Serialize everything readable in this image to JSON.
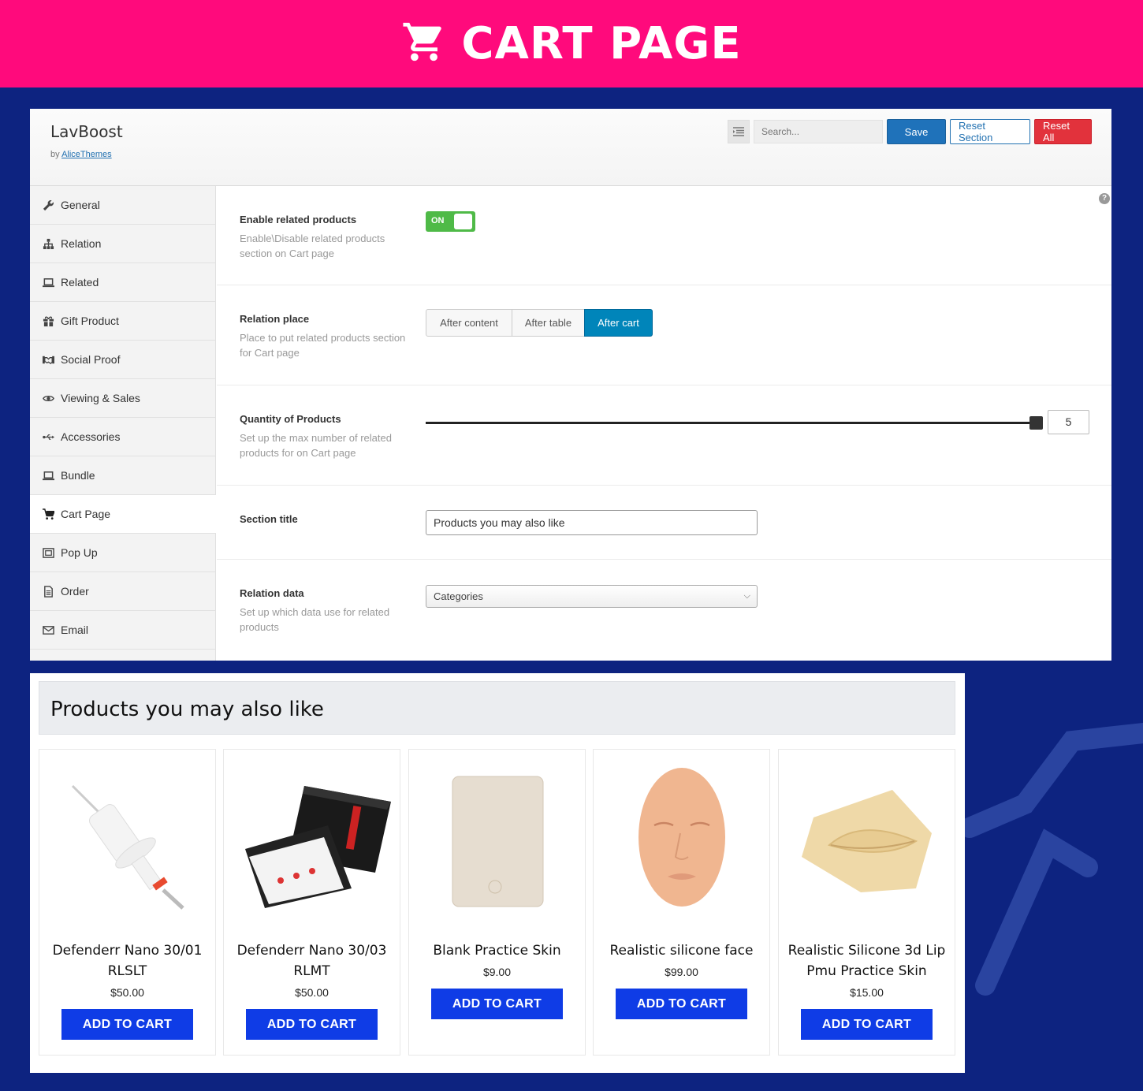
{
  "banner": {
    "title": "CART PAGE",
    "icon": "cart-icon"
  },
  "admin": {
    "brand": "LavBoost",
    "by_prefix": "by",
    "by_link": "AliceThemes",
    "search_placeholder": "Search...",
    "save_label": "Save",
    "reset_section_label": "Reset Section",
    "reset_all_label": "Reset All",
    "help_glyph": "?",
    "sidebar": [
      {
        "label": "General",
        "icon": "wrench-icon"
      },
      {
        "label": "Relation",
        "icon": "sitemap-icon"
      },
      {
        "label": "Related",
        "icon": "laptop-icon"
      },
      {
        "label": "Gift Product",
        "icon": "gift-icon"
      },
      {
        "label": "Social Proof",
        "icon": "handshake-icon"
      },
      {
        "label": "Viewing & Sales",
        "icon": "eye-icon"
      },
      {
        "label": "Accessories",
        "icon": "usb-icon"
      },
      {
        "label": "Bundle",
        "icon": "laptop-icon"
      },
      {
        "label": "Cart Page",
        "icon": "cart-icon",
        "active": true
      },
      {
        "label": "Pop Up",
        "icon": "popup-icon"
      },
      {
        "label": "Order",
        "icon": "document-icon"
      },
      {
        "label": "Email",
        "icon": "envelope-icon"
      }
    ],
    "settings": {
      "enable": {
        "title": "Enable related products",
        "desc": "Enable\\Disable related products section on Cart page",
        "toggle_label": "ON",
        "value": true
      },
      "place": {
        "title": "Relation place",
        "desc": "Place to put related products section for Cart page",
        "options": [
          "After content",
          "After table",
          "After cart"
        ],
        "selected": "After cart"
      },
      "quantity": {
        "title": "Quantity of Products",
        "desc": "Set up the max number of related products for on Cart page",
        "value": "5",
        "fill": 1.0
      },
      "section_title": {
        "title": "Section title",
        "value": "Products you may also like"
      },
      "relation_data": {
        "title": "Relation data",
        "desc": "Set up which data use for related products",
        "value": "Categories"
      }
    }
  },
  "store": {
    "title": "Products you may also like",
    "button_label": "ADD TO CART",
    "products": [
      {
        "name": "Defenderr Nano 30/01 RLSLT",
        "price": "$50.00",
        "image": "needle-cartridge-image"
      },
      {
        "name": "Defenderr Nano 30/03 RLMT",
        "price": "$50.00",
        "image": "cartridge-box-image"
      },
      {
        "name": "Blank Practice Skin",
        "price": "$9.00",
        "image": "practice-skin-image"
      },
      {
        "name": "Realistic silicone face",
        "price": "$99.00",
        "image": "silicone-face-image"
      },
      {
        "name": "Realistic Silicone 3d Lip Pmu Practice Skin",
        "price": "$15.00",
        "image": "silicone-lip-image"
      }
    ]
  },
  "colors": {
    "banner": "#ff0a7c",
    "background": "#0d2380",
    "cart_button": "#0f3ce6",
    "toggle_on": "#4fba47",
    "selected_segment": "#0085ba"
  }
}
